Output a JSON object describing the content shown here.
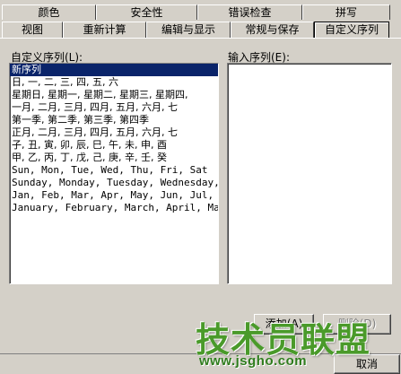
{
  "tabs_row1": [
    {
      "label": "颜色"
    },
    {
      "label": "安全性"
    },
    {
      "label": "错误检查"
    },
    {
      "label": "拼写"
    }
  ],
  "tabs_row2": [
    {
      "label": "视图"
    },
    {
      "label": "重新计算"
    },
    {
      "label": "编辑与显示"
    },
    {
      "label": "常规与保存"
    },
    {
      "label": "自定义序列",
      "active": true
    }
  ],
  "custom_lists": {
    "label": "自定义序列(L):",
    "items": [
      "新序列",
      "日, 一, 二, 三, 四, 五, 六",
      "星期日, 星期一, 星期二, 星期三, 星期四,",
      "一月, 二月, 三月, 四月, 五月, 六月, 七",
      "第一季, 第二季, 第三季, 第四季",
      "正月, 二月, 三月, 四月, 五月, 六月, 七",
      "子, 丑, 寅, 卯, 辰, 巳, 午, 未, 申, 酉",
      "甲, 乙, 丙, 丁, 戊, 己, 庚, 辛, 壬, 癸",
      "Sun, Mon, Tue, Wed, Thu, Fri, Sat",
      "Sunday, Monday, Tuesday, Wednesday, Th",
      "Jan, Feb, Mar, Apr, May, Jun, Jul, Aug",
      "January, February, March, April, May,"
    ],
    "selected_index": 0
  },
  "input_entries": {
    "label": "输入序列(E):",
    "value": ""
  },
  "buttons": {
    "add": "添加(A)",
    "delete": "删除(D)",
    "cancel": "取消"
  },
  "watermark": {
    "title": "技术员联盟",
    "url": "www.jsgho.com"
  },
  "colors": {
    "dialog_bg": "#d4d0c8",
    "selection": "#0a246a",
    "watermark_green": "#4a9a2a"
  }
}
